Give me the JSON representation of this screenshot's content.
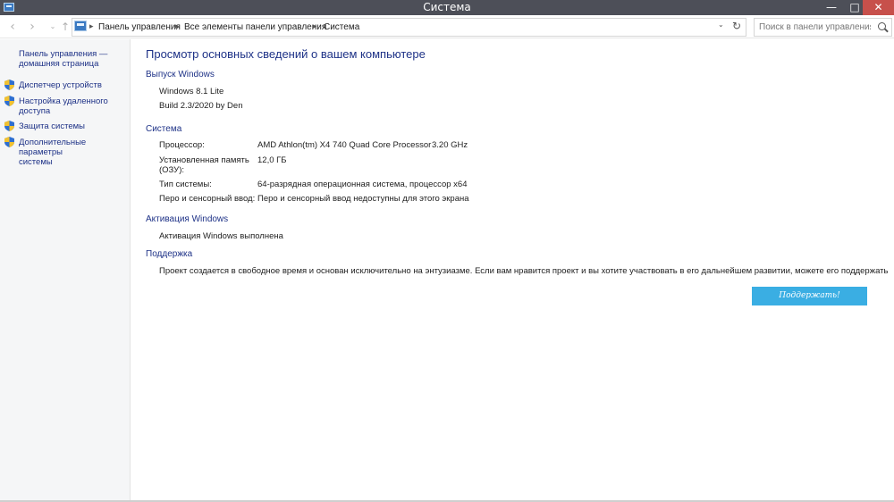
{
  "window": {
    "title": "Система",
    "minimize_glyph": "—",
    "maximize_glyph": "□",
    "close_glyph": "✕"
  },
  "nav": {
    "back_icon": "‹",
    "forward_icon": "›",
    "recent_icon": "⌄",
    "up_icon": "↑",
    "breadcrumb": [
      "Панель управления",
      "Все элементы панели управления",
      "Система"
    ],
    "separator": "▸",
    "dropdown_icon": "⌄",
    "refresh_icon": "↻",
    "search_placeholder": "Поиск в панели управления"
  },
  "sidebar": {
    "home_link": [
      "Панель управления —",
      "домашняя страница"
    ],
    "items": [
      {
        "lines": [
          "Диспетчер устройств"
        ],
        "icon": "shield-icon"
      },
      {
        "lines": [
          "Настройка удаленного",
          "доступа"
        ],
        "icon": "shield-icon"
      },
      {
        "lines": [
          "Защита системы"
        ],
        "icon": "shield-icon"
      },
      {
        "lines": [
          "Дополнительные параметры",
          "системы"
        ],
        "icon": "shield-icon"
      }
    ]
  },
  "main": {
    "title": "Просмотр основных сведений о вашем компьютере",
    "edition": {
      "heading": "Выпуск Windows",
      "name": "Windows 8.1 Lite",
      "build": "Build 2.3/2020 by Den"
    },
    "system": {
      "heading": "Система",
      "processor_label": "Процессор:",
      "processor_value": "AMD Athlon(tm) X4 740 Quad Core Processor",
      "processor_speed": "3.20 GHz",
      "ram_label": [
        "Установленная память",
        "(ОЗУ):"
      ],
      "ram_value": "12,0 ГБ",
      "type_label": "Тип системы:",
      "type_value": "64-разрядная операционная система, процессор x64",
      "pen_label": "Перо и сенсорный ввод:",
      "pen_value": "Перо и сенсорный ввод недоступны для этого экрана"
    },
    "activation": {
      "heading": "Активация Windows",
      "status": "Активация Windows выполнена"
    },
    "support": {
      "heading": "Поддержка",
      "text": "Проект создается в свободное время и основан исключительно на энтузиазме. Если вам нравится проект и вы хотите участвовать в его дальнейшем развитии, можете его поддержать",
      "button_label": "Поддержать!"
    }
  },
  "colors": {
    "titlebar": "#4d4f58",
    "close_button": "#c7504b",
    "link": "#1e3287",
    "support_button": "#3aaee3"
  }
}
